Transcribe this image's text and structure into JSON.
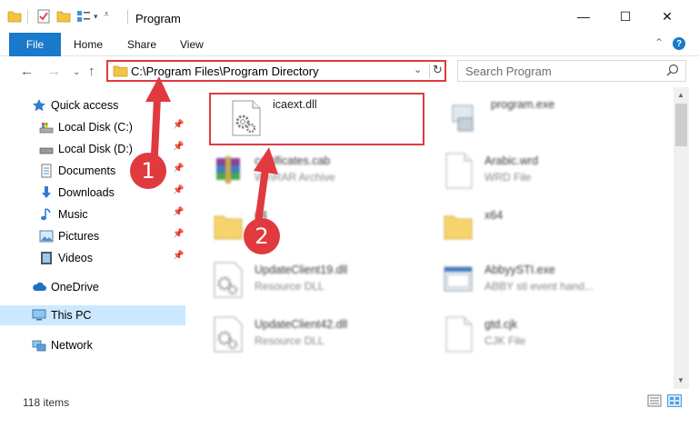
{
  "window": {
    "title": "Program",
    "minimize": "—",
    "maximize": "☐",
    "close": "✕"
  },
  "ribbon": {
    "file": "File",
    "home": "Home",
    "share": "Share",
    "view": "View",
    "collapse": "⌄",
    "help": "?"
  },
  "nav": {
    "back": "←",
    "forward": "→",
    "recent": "⌄",
    "up": "↑"
  },
  "address": {
    "path": "C:\\Program Files\\Program Directory",
    "dropdown": "⌄",
    "refresh": "↻"
  },
  "search": {
    "placeholder": "Search Program"
  },
  "sidebar": {
    "items": [
      {
        "label": "Quick access",
        "icon": "star-icon"
      },
      {
        "label": "Local Disk (C:)",
        "icon": "drive-icon",
        "pinned": true
      },
      {
        "label": "Local Disk (D:)",
        "icon": "drive-icon",
        "pinned": true
      },
      {
        "label": "Documents",
        "icon": "documents-icon",
        "pinned": true
      },
      {
        "label": "Downloads",
        "icon": "download-icon",
        "pinned": true
      },
      {
        "label": "Music",
        "icon": "music-icon",
        "pinned": true
      },
      {
        "label": "Pictures",
        "icon": "pictures-icon",
        "pinned": true
      },
      {
        "label": "Videos",
        "icon": "videos-icon",
        "pinned": true
      },
      {
        "label": "OneDrive",
        "icon": "cloud-icon"
      },
      {
        "label": "This PC",
        "icon": "computer-icon",
        "selected": true
      },
      {
        "label": "Network",
        "icon": "network-icon"
      }
    ],
    "pin_glyph": "📌"
  },
  "files": [
    {
      "name": "icaext.dll",
      "type": "",
      "icon": "dll-gear-icon",
      "blurred": false
    },
    {
      "name": "program.exe",
      "type": "",
      "icon": "exe-icon",
      "blurred": true
    },
    {
      "name": "certificates.cab",
      "type": "WinRAR Archive",
      "icon": "winrar-icon",
      "blurred": true
    },
    {
      "name": "Arabic.wrd",
      "type": "WRD File",
      "icon": "blank-file-icon",
      "blurred": true
    },
    {
      "name": "64",
      "type": "",
      "icon": "folder-icon",
      "blurred": true
    },
    {
      "name": "x64",
      "type": "",
      "icon": "folder-icon",
      "blurred": true
    },
    {
      "name": "UpdateClient19.dll",
      "type": "Resource DLL",
      "icon": "dll-gear-icon",
      "blurred": true
    },
    {
      "name": "AbbyySTI.exe",
      "type": "ABBY sti event hand...",
      "icon": "exe-window-icon",
      "blurred": true
    },
    {
      "name": "UpdateClient42.dll",
      "type": "Resource DLL",
      "icon": "dll-gear-icon",
      "blurred": true
    },
    {
      "name": "gtd.cjk",
      "type": "CJK File",
      "icon": "blank-file-icon",
      "blurred": true
    }
  ],
  "markers": {
    "one": "1",
    "two": "2"
  },
  "status": {
    "count": "118 items"
  },
  "colors": {
    "accent": "#1979ca",
    "annotation": "#e03a3f",
    "selected": "#cce8ff"
  }
}
